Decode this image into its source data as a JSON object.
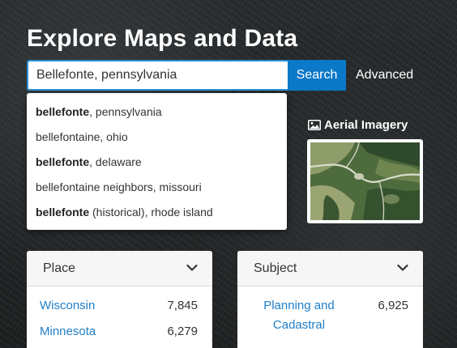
{
  "header": {
    "title": "Explore Maps and Data"
  },
  "search": {
    "value": "Bellefonte, pennsylvania",
    "button_label": "Search",
    "advanced_label": "Advanced"
  },
  "suggestions": [
    {
      "bold": "bellefonte",
      "rest": ", pennsylvania"
    },
    {
      "bold": "",
      "rest": "bellefontaine, ohio"
    },
    {
      "bold": "bellefonte",
      "rest": ", delaware"
    },
    {
      "bold": "",
      "rest": "bellefontaine neighbors, missouri"
    },
    {
      "bold": "bellefonte",
      "rest": " (historical), rhode island"
    }
  ],
  "aerial": {
    "label": "Aerial Imagery",
    "icon": "image-icon"
  },
  "place_card": {
    "title": "Place",
    "items": [
      {
        "label": "Wisconsin",
        "count": "7,845"
      },
      {
        "label": "Minnesota",
        "count": "6,279"
      }
    ]
  },
  "subject_card": {
    "title": "Subject",
    "items": [
      {
        "label": "Planning and Cadastral",
        "count": "6,925"
      }
    ]
  },
  "colors": {
    "accent": "#0b78c8",
    "link": "#1f7ec7",
    "title": "#ffffff"
  }
}
